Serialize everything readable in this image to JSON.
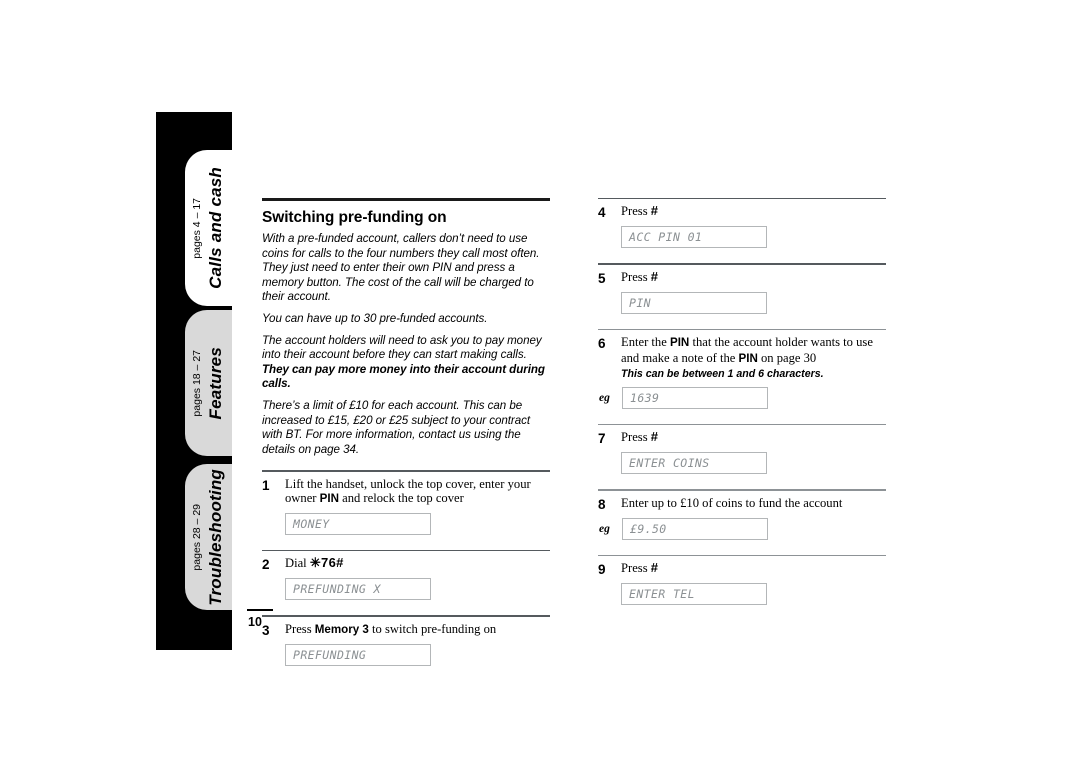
{
  "page": {
    "number": "10"
  },
  "side_tabs": [
    {
      "title": "Calls and cash",
      "pages": "pages 4 – 17",
      "state": "active"
    },
    {
      "title": "Features",
      "pages": "pages 18 – 27",
      "state": "inactive"
    },
    {
      "title": "Troubleshooting",
      "pages": "pages 28 – 29",
      "state": "inactive"
    }
  ],
  "section": {
    "title": "Switching pre-funding on",
    "intro": [
      "With a pre-funded account, callers don’t need to use coins for calls to the four numbers they call most often. They just need to enter their own PIN and press a memory button. The cost of the call will be charged to their account.",
      "You can have up to 30 pre-funded accounts.",
      "There’s a limit of £10 for each account. This can be increased to £15, £20 or £25 subject to your contract with BT. For more information, contact us using the details on page 34."
    ],
    "intro_mixed": {
      "plain": "The account holders will need to ask you to pay money into their account before they can start making calls. ",
      "bold": "They can pay more money into their account during calls."
    }
  },
  "steps_left": [
    {
      "num": "1",
      "text_parts": {
        "a": "Lift the handset, unlock the top cover, enter your owner ",
        "b": "PIN",
        "c": " and relock the top cover"
      },
      "lcd": "MONEY",
      "eg": ""
    },
    {
      "num": "2",
      "text_parts": {
        "a": "Dial ",
        "sym": "✳︎76#",
        "c": ""
      },
      "lcd": "PREFUNDING X",
      "eg": ""
    },
    {
      "num": "3",
      "text_parts": {
        "a": "Press ",
        "b": "Memory 3",
        "c": " to switch pre-funding on"
      },
      "lcd": "PREFUNDING",
      "eg": ""
    }
  ],
  "steps_right": [
    {
      "num": "4",
      "text_parts": {
        "a": "Press ",
        "sym": "#",
        "c": ""
      },
      "lcd": "ACC PIN 01",
      "eg": ""
    },
    {
      "num": "5",
      "text_parts": {
        "a": "Press ",
        "sym": "#",
        "c": ""
      },
      "lcd": "PIN",
      "eg": ""
    },
    {
      "num": "6",
      "text_parts": {
        "a": "Enter the ",
        "b": "PIN",
        "c": " that the account holder wants to use and make a note of the ",
        "b2": "PIN",
        "d": " on page 30"
      },
      "note": "This can be between 1 and 6 characters.",
      "lcd": "1639",
      "eg": "eg"
    },
    {
      "num": "7",
      "text_parts": {
        "a": "Press ",
        "sym": "#",
        "c": ""
      },
      "lcd": "ENTER COINS",
      "eg": ""
    },
    {
      "num": "8",
      "text_parts": {
        "a": "Enter up to £10 of coins to fund the account",
        "c": ""
      },
      "lcd": "£9.50",
      "eg": "eg"
    },
    {
      "num": "9",
      "text_parts": {
        "a": "Press ",
        "sym": "#",
        "c": ""
      },
      "lcd": "ENTER TEL",
      "eg": ""
    }
  ]
}
